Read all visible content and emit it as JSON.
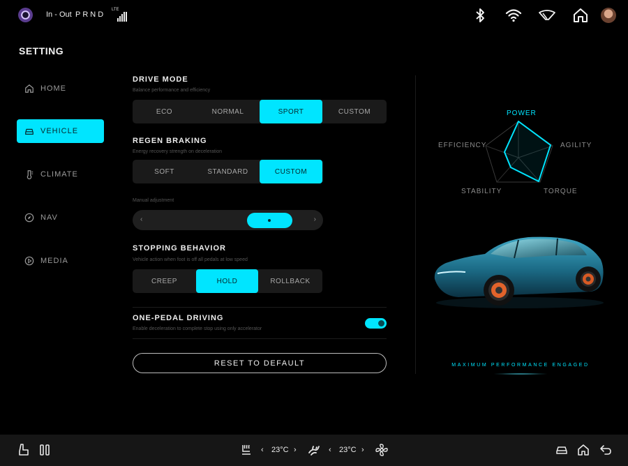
{
  "status": {
    "inout_label": "In - Out",
    "gear_label": "PRND",
    "network_label": "LTE",
    "icons": [
      "app-logo-icon",
      "bluetooth-icon",
      "wifi-icon",
      "wiper-icon",
      "home-icon",
      "profile-avatar"
    ]
  },
  "page_title": "SETTING",
  "sidebar": {
    "items": [
      {
        "label": "HOME",
        "icon": "home-icon",
        "active": false
      },
      {
        "label": "VEHICLE",
        "icon": "car-icon",
        "active": true
      },
      {
        "label": "CLIMATE",
        "icon": "thermometer-icon",
        "active": false
      },
      {
        "label": "NAV",
        "icon": "compass-icon",
        "active": false
      },
      {
        "label": "MEDIA",
        "icon": "play-icon",
        "active": false
      }
    ]
  },
  "drive_mode": {
    "title": "DRIVE MODE",
    "subtitle": "Balance performance and efficiency",
    "options": [
      "ECO",
      "NORMAL",
      "SPORT",
      "CUSTOM"
    ],
    "selected": "SPORT"
  },
  "regen": {
    "title": "REGEN BRAKING",
    "subtitle": "Energy recovery strength on deceleration",
    "options": [
      "SOFT",
      "STANDARD",
      "CUSTOM"
    ],
    "selected": "CUSTOM",
    "manual_label": "Manual adjustment",
    "left_arrow": "‹",
    "right_arrow": "›",
    "level_fraction": 0.72
  },
  "stopping": {
    "title": "STOPPING BEHAVIOR",
    "subtitle": "Vehicle action when foot is off all pedals at low speed",
    "options": [
      "CREEP",
      "HOLD",
      "ROLLBACK"
    ],
    "selected": "HOLD"
  },
  "one_pedal": {
    "title": "ONE-PEDAL DRIVING",
    "subtitle": "Enable deceleration to complete stop using only accelerator",
    "enabled": true
  },
  "reset_label": "RESET TO DEFAULT",
  "radar": {
    "labels": {
      "power": "POWER",
      "agility": "AGILITY",
      "torque": "TORQUE",
      "stability": "STABILITY",
      "efficiency": "EFFICIENCY"
    },
    "highlight": "power",
    "accent": "#00e5ff"
  },
  "status_message": "MAXIMUM PERFORMANCE ENGAGED",
  "bottom": {
    "left_temp": "23°C",
    "right_temp": "23°C",
    "prev": "‹",
    "next": "›"
  },
  "colors": {
    "accent": "#00e5ff",
    "background": "#000000",
    "panel": "#1a1a1a"
  }
}
